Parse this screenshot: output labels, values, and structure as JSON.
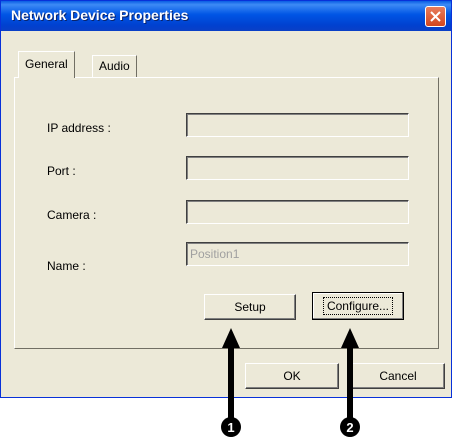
{
  "window": {
    "title": "Network Device Properties"
  },
  "tabs": [
    {
      "label": "General",
      "active": true
    },
    {
      "label": "Audio",
      "active": false
    }
  ],
  "fields": [
    {
      "label": "IP address :",
      "value": ""
    },
    {
      "label": "Port :",
      "value": ""
    },
    {
      "label": "Camera :",
      "value": ""
    },
    {
      "label": "Name :",
      "value": "",
      "placeholder": "Position1"
    }
  ],
  "buttons": {
    "setup": "Setup",
    "configure": "Configure...",
    "ok": "OK",
    "cancel": "Cancel"
  },
  "callouts": [
    "1",
    "2"
  ]
}
